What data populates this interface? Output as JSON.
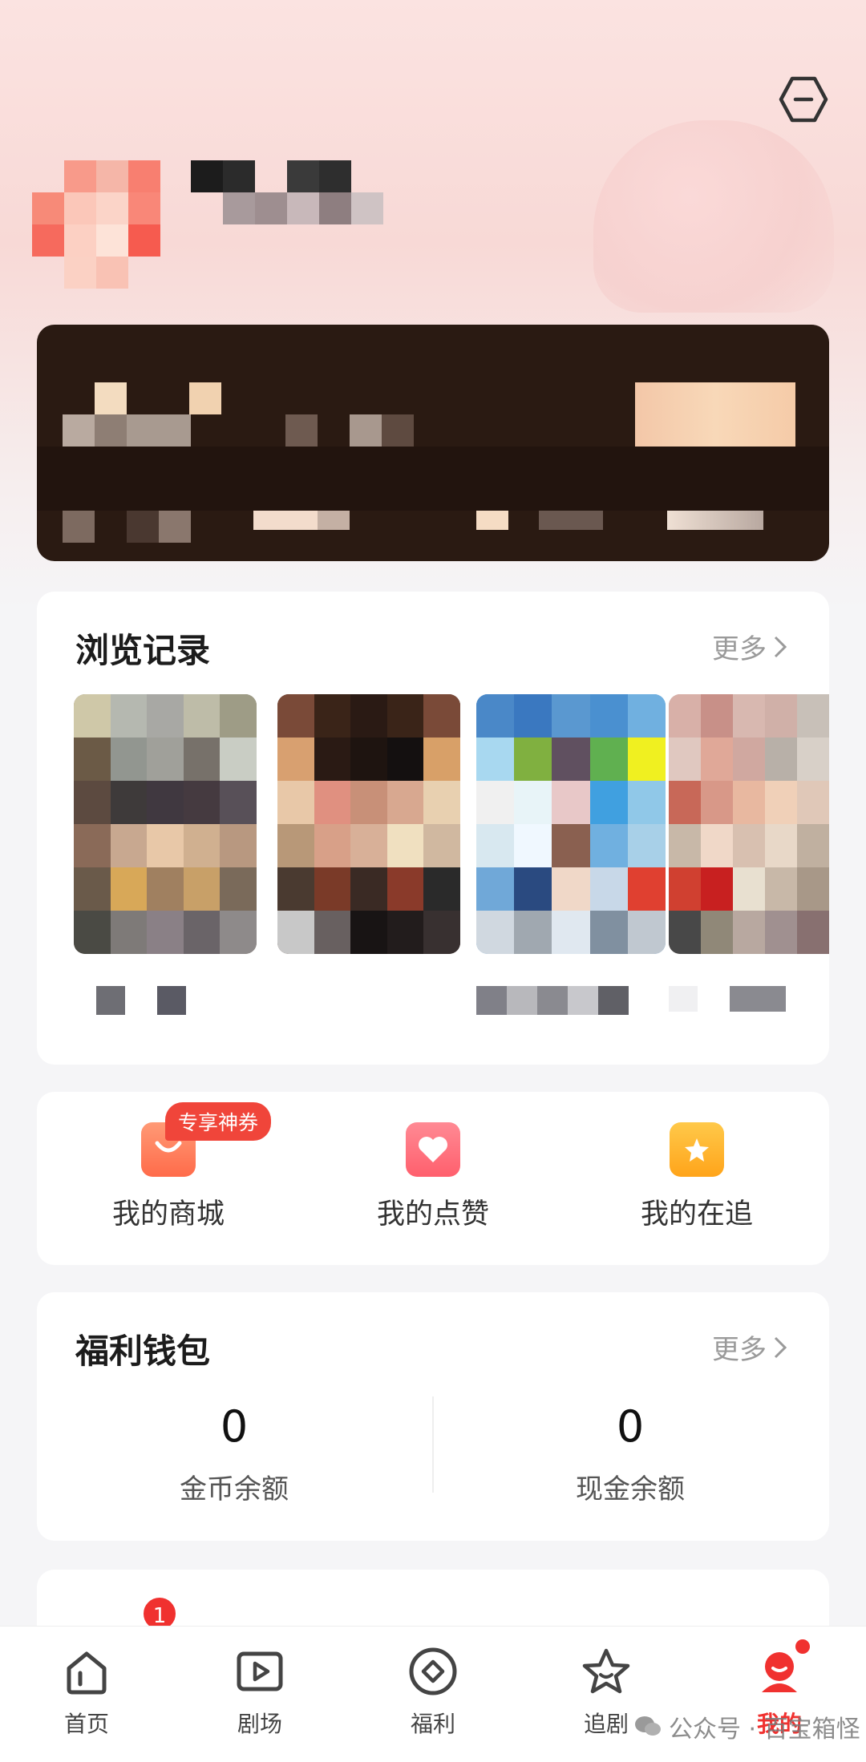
{
  "header": {
    "settings_icon": "hexagon-minus-icon"
  },
  "history": {
    "title": "浏览记录",
    "more_label": "更多"
  },
  "shortcuts": {
    "items": [
      {
        "label": "我的商城",
        "icon": "shopping-bag-icon",
        "color": "#ff7a5a"
      },
      {
        "label": "我的点赞",
        "icon": "heart-icon",
        "color": "#ff5f6d"
      },
      {
        "label": "我的在追",
        "icon": "star-folder-icon",
        "color": "#ffb020"
      }
    ],
    "promo_badge": "专享神券"
  },
  "wallet": {
    "title": "福利钱包",
    "more_label": "更多",
    "coin_value": "0",
    "coin_label": "金币余额",
    "cash_value": "0",
    "cash_label": "现金余额"
  },
  "tabbar": {
    "items": [
      {
        "label": "首页",
        "icon": "home-icon"
      },
      {
        "label": "剧场",
        "icon": "play-icon"
      },
      {
        "label": "福利",
        "icon": "diamond-coin-icon"
      },
      {
        "label": "追剧",
        "icon": "star-face-icon"
      },
      {
        "label": "我的",
        "icon": "profile-icon"
      }
    ],
    "notification_count": "1",
    "active": "我的"
  },
  "watermark": {
    "text": "公众号 · 百宝箱怪"
  },
  "colors": {
    "accent": "#f0312f",
    "promo": "#f0453a",
    "vip_card_bg": "#2a1a12"
  }
}
